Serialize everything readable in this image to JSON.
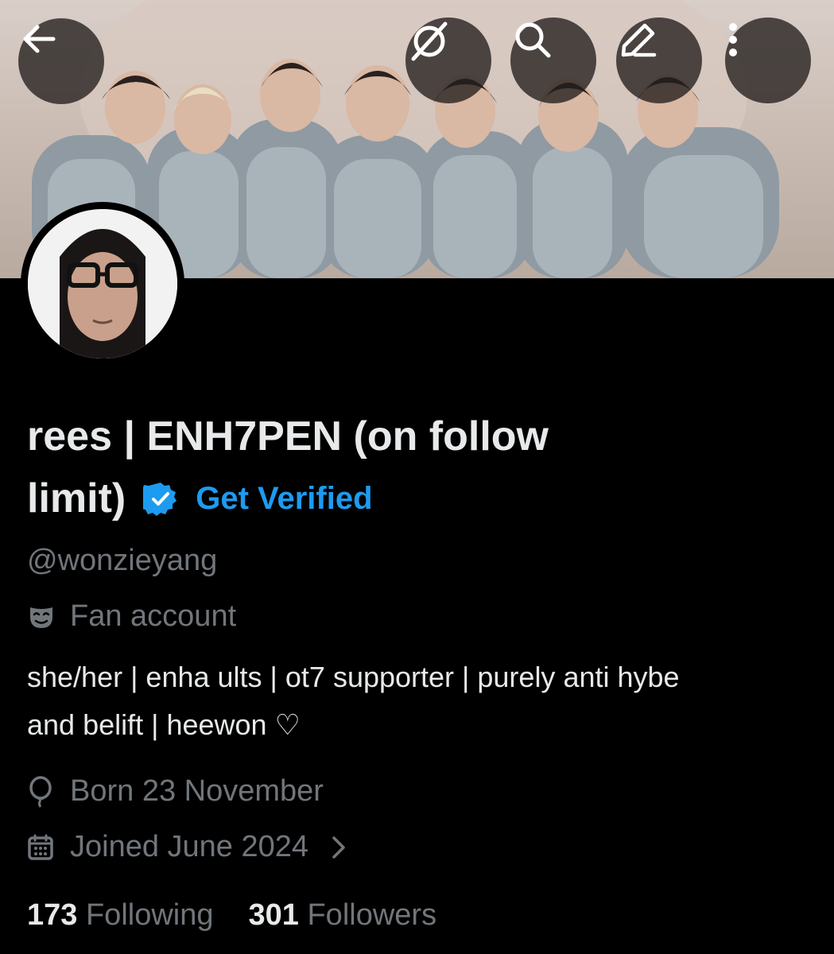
{
  "profile": {
    "display_name_line1": "rees | ENH7PEN (on follow",
    "display_name_line2": "limit)",
    "get_verified": "Get Verified",
    "handle": "@wonzieyang",
    "category": "Fan account",
    "bio_line1": "she/her | enha ults | ot7 supporter | purely anti hybe",
    "bio_line2": "and belift | heewon ♡",
    "birthday": "Born 23 November",
    "joined": "Joined June 2024",
    "following_count": "173",
    "following_label": "Following",
    "followers_count": "301",
    "followers_label": "Followers"
  },
  "icons": {
    "back": "back-arrow-icon",
    "grok": "grok-icon",
    "search": "search-icon",
    "edit": "edit-icon",
    "more": "more-icon",
    "verified": "verified-badge-icon",
    "category": "mask-icon",
    "birthday": "balloon-icon",
    "joined": "calendar-icon",
    "chevron": "chevron-right-icon"
  },
  "colors": {
    "accent": "#1d9bf0",
    "background": "#000000",
    "primary_text": "#e7e9ea",
    "secondary_text": "#71767b"
  }
}
